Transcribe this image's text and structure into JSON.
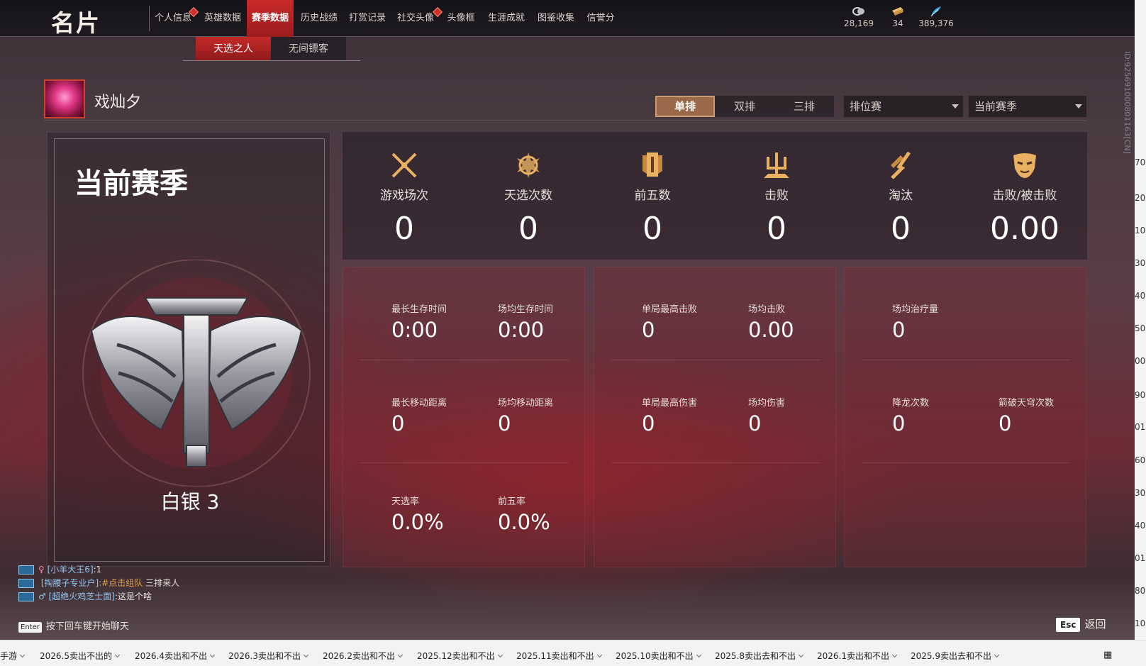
{
  "header": {
    "title": "名片",
    "nav_tabs": [
      "个人信息",
      "英雄数据",
      "赛季数据",
      "历史战绩",
      "打赏记录",
      "社交头像",
      "头像框",
      "生涯成就",
      "图鉴收集",
      "信誉分"
    ],
    "active_tab": "赛季数据",
    "currencies": [
      {
        "icon": "coin-icon",
        "value": "28,169"
      },
      {
        "icon": "ticket-icon",
        "value": "34"
      },
      {
        "icon": "feather-icon",
        "value": "389,376"
      }
    ]
  },
  "sub_tabs": [
    "天选之人",
    "无间镖客"
  ],
  "player": {
    "name": "戏灿夕",
    "id_text": "ID:925691000801163[CN]"
  },
  "modes": [
    "单排",
    "双排",
    "三排"
  ],
  "active_mode": "单排",
  "filters": {
    "match_type": "排位赛",
    "season": "当前赛季"
  },
  "rank": {
    "season_title": "当前赛季",
    "rank_name": "白银 3"
  },
  "stats": [
    {
      "icon": "crossed-swords-icon",
      "label": "游戏场次",
      "value": "0"
    },
    {
      "icon": "lotus-emblem-icon",
      "label": "天选次数",
      "value": "0"
    },
    {
      "icon": "banner-icon",
      "label": "前五数",
      "value": "0"
    },
    {
      "icon": "trident-icon",
      "label": "击败",
      "value": "0"
    },
    {
      "icon": "broken-blade-icon",
      "label": "淘汰",
      "value": "0"
    },
    {
      "icon": "mask-icon",
      "label": "击败/被击败",
      "value": "0.00"
    }
  ],
  "details": {
    "survival": {
      "longest_survival": {
        "label": "最长生存时间",
        "value": "0:00"
      },
      "avg_survival": {
        "label": "场均生存时间",
        "value": "0:00"
      },
      "longest_move": {
        "label": "最长移动距离",
        "value": "0"
      },
      "avg_move": {
        "label": "场均移动距离",
        "value": "0"
      },
      "chosen_rate": {
        "label": "天选率",
        "value": "0.0%"
      },
      "top5_rate": {
        "label": "前五率",
        "value": "0.0%"
      }
    },
    "combat": {
      "max_kills": {
        "label": "单局最高击败",
        "value": "0"
      },
      "avg_kills": {
        "label": "场均击败",
        "value": "0.00"
      },
      "max_damage": {
        "label": "单局最高伤害",
        "value": "0"
      },
      "avg_damage": {
        "label": "场均伤害",
        "value": "0"
      }
    },
    "support": {
      "avg_heal": {
        "label": "场均治疗量",
        "value": "0"
      },
      "dragon_count": {
        "label": "降龙次数",
        "value": "0"
      },
      "arrow_count": {
        "label": "箭破天穹次数",
        "value": "0"
      }
    }
  },
  "chat": {
    "lines": [
      {
        "who": "[小羊大王6]",
        "msg": ":1"
      },
      {
        "who": "[掏腰子专业户]",
        "highlight": ":#点击组队",
        "msg": " 三排来人"
      },
      {
        "who": "[超绝火鸡芝士面]",
        "msg": ":这是个啥"
      }
    ],
    "enter_key": "Enter",
    "hint": "按下回车键开始聊天"
  },
  "esc": {
    "key": "Esc",
    "label": "返回"
  },
  "right_strip_fragments": [
    "70",
    "20",
    "10",
    "30",
    "40",
    "50",
    "00",
    "90",
    "016",
    "60",
    "30",
    "40",
    "01",
    "80",
    "10"
  ],
  "taskbar": [
    "手游",
    "2026.5卖出不出的",
    "2026.4卖出和不出",
    "2026.3卖出和不出",
    "2026.2卖出和不出",
    "2025.12卖出和不出",
    "2025.11卖出和不出",
    "2025.10卖出和不出",
    "2025.8卖出去和不出",
    "2026.1卖出和不出",
    "2025.9卖出去和不出"
  ],
  "colors": {
    "accent_red": "#c42a28",
    "mode_active": "#9a6a4a",
    "chat_name": "#8cc6f0",
    "chat_highlight": "#e8a040"
  }
}
